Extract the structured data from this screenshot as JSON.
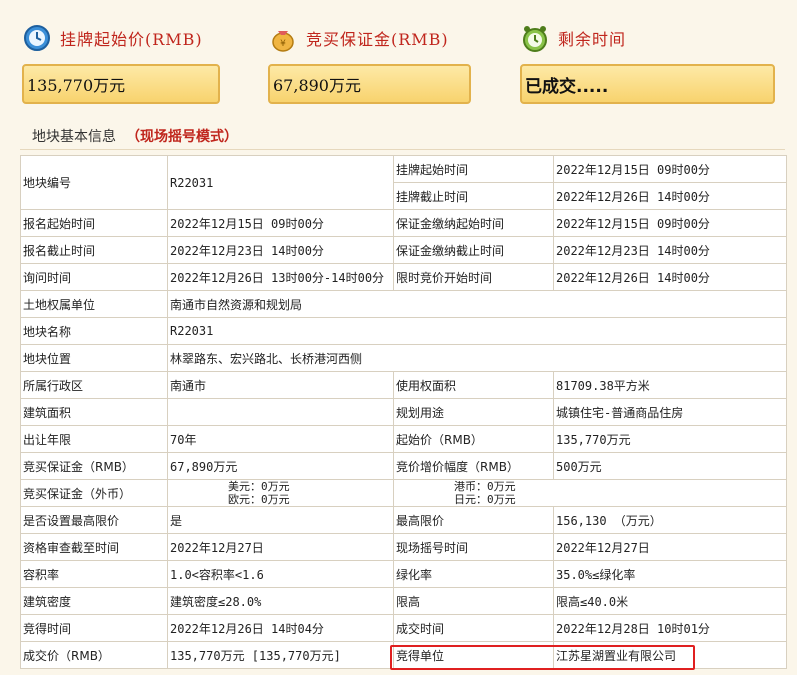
{
  "panels": [
    {
      "title": "挂牌起始价(RMB)",
      "value": "135,770万元",
      "icon": "clock-icon"
    },
    {
      "title": "竞买保证金(RMB)",
      "value": "67,890万元",
      "icon": "money-bag-icon"
    },
    {
      "title": "剩余时间",
      "value": "已成交.....",
      "icon": "alarm-clock-icon"
    }
  ],
  "section": {
    "label": "地块基本信息",
    "mode": "（现场摇号模式）"
  },
  "table": {
    "first_row": {
      "label": "地块编号",
      "value": "R22031",
      "sub": [
        {
          "label": "挂牌起始时间",
          "value": "2022年12月15日 09时00分"
        },
        {
          "label": "挂牌截止时间",
          "value": "2022年12月26日 14时00分"
        }
      ]
    },
    "rows": [
      {
        "cells": [
          "报名起始时间",
          "2022年12月15日 09时00分",
          "保证金缴纳起始时间",
          "2022年12月15日 09时00分"
        ]
      },
      {
        "cells": [
          "报名截止时间",
          "2022年12月23日 14时00分",
          "保证金缴纳截止时间",
          "2022年12月23日 14时00分"
        ]
      },
      {
        "cells": [
          "询问时间",
          "2022年12月26日 13时00分-14时00分",
          "限时竞价开始时间",
          "2022年12月26日 14时00分"
        ]
      },
      {
        "wide": true,
        "cells": [
          "土地权属单位",
          "南通市自然资源和规划局"
        ]
      },
      {
        "wide": true,
        "cells": [
          "地块名称",
          "R22031"
        ]
      },
      {
        "wide": true,
        "cells": [
          "地块位置",
          "林翠路东、宏兴路北、长桥港河西侧"
        ]
      },
      {
        "cells": [
          "所属行政区",
          "南通市",
          "使用权面积",
          "81709.38平方米"
        ]
      },
      {
        "cells": [
          "建筑面积",
          "",
          "规划用途",
          "城镇住宅-普通商品住房"
        ]
      },
      {
        "cells": [
          "出让年限",
          "70年",
          "起始价（RMB）",
          "135,770万元"
        ]
      },
      {
        "cells": [
          "竞买保证金（RMB）",
          "67,890万元",
          "竞价增价幅度（RMB）",
          "500万元"
        ]
      },
      {
        "foreign": true,
        "cells": [
          "竞买保证金（外币）",
          "美元：0万元",
          "欧元：0万元",
          "港币：0万元",
          "日元：0万元"
        ]
      },
      {
        "cells": [
          "是否设置最高限价",
          "是",
          "最高限价",
          "156,130 （万元）"
        ]
      },
      {
        "cells": [
          "资格审查截至时间",
          "2022年12月27日",
          "现场摇号时间",
          "2022年12月27日"
        ]
      },
      {
        "cells": [
          "容积率",
          "1.0<容积率<1.6",
          "绿化率",
          "35.0%≤绿化率"
        ]
      },
      {
        "cells": [
          "建筑密度",
          "建筑密度≤28.0%",
          "限高",
          "限高≤40.0米"
        ]
      },
      {
        "cells": [
          "竞得时间",
          "2022年12月26日 14时04分",
          "成交时间",
          "2022年12月28日 10时01分"
        ]
      },
      {
        "cells": [
          "成交价（RMB）",
          "135,770万元 [135,770万元]",
          "竞得单位",
          "江苏星湖置业有限公司"
        ]
      }
    ]
  },
  "colors": {
    "accent_red": "#c0261d",
    "value_box": "#f8d36e",
    "highlight": "#e02020"
  }
}
